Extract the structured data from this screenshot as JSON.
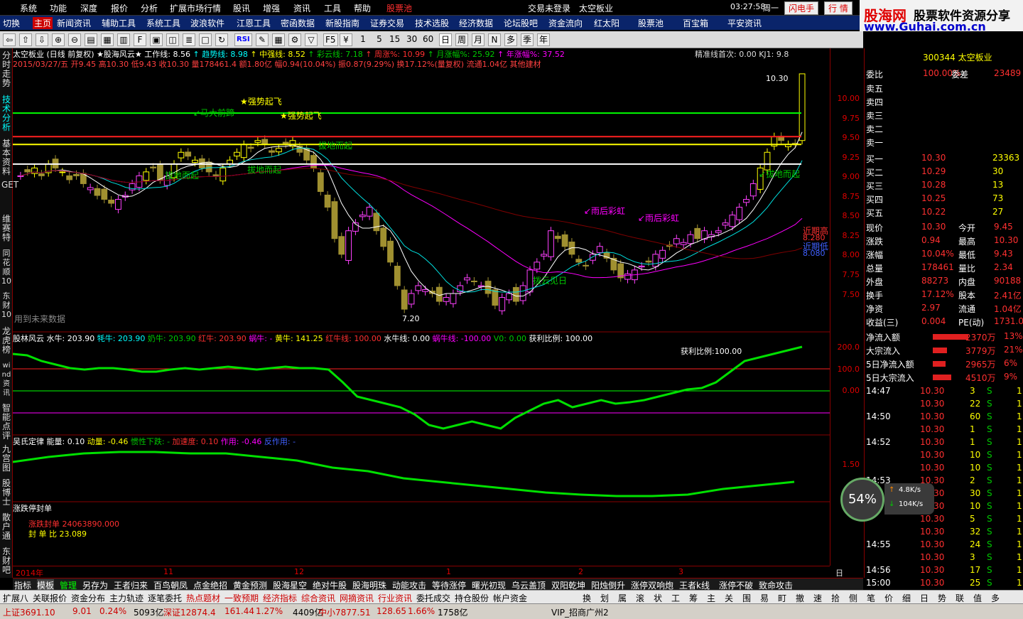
{
  "menu": {
    "items": [
      "系统",
      "功能",
      "深度",
      "报价",
      "分析",
      "扩展市场行情",
      "股讯",
      "增强",
      "资讯",
      "工具",
      "帮助",
      "股票池"
    ],
    "login": "交易未登录",
    "stock_title": "太空板业",
    "time": "03:27:58",
    "weekday": "周一",
    "btn_flash": "闪电手",
    "btn_quote": "行  情"
  },
  "brand": {
    "name": "股海网",
    "slogan": "股票软件资源分享",
    "url": "www.Guhai.com.cn"
  },
  "toolbar1": [
    "切换",
    "主页",
    "新闻资讯",
    "辅助工具",
    "系统工具",
    "波浪软件",
    "江恩工具",
    "密函数据",
    "新股指南",
    "证券交易",
    "技术选股",
    "经济数据",
    "论坛股吧",
    "资金流向",
    "红太阳",
    "股票池",
    "百宝箱",
    "平安资讯"
  ],
  "toolbar2": {
    "periods": [
      "1",
      "5",
      "15",
      "30",
      "60",
      "日",
      "周",
      "月",
      "N",
      "多",
      "季",
      "年"
    ],
    "rsi": "RSI"
  },
  "side_tabs": [
    "分时走势",
    "技术分析",
    "基本资料",
    "GET",
    "维赛特",
    "同花顺10",
    "东财10",
    "龙虎榜",
    "wind资讯",
    "智能点评",
    "九宫图",
    "股博士",
    "散户通",
    "东财吧"
  ],
  "header": {
    "line1": [
      {
        "t": "太空板业 (日线 前复权) ★股海风云★ 工作线: 8.56",
        "c": "ww"
      },
      {
        "t": "↑ 趋势线: 8.98",
        "c": "cc"
      },
      {
        "t": "↑ 中强线: 8.52",
        "c": "yy"
      },
      {
        "t": "↑ 彩云线: 7.18",
        "c": "gg"
      },
      {
        "t": "↑ 周涨%: 10.99",
        "c": "rr"
      },
      {
        "t": "↑ 月涨幅%: 25.92",
        "c": "gg"
      },
      {
        "t": "↑ 年涨幅%: 37.52",
        "c": "mm"
      }
    ],
    "line2": "2015/03/27/五 开9.45 高10.30 低9.43 收10.30 量178461.4 额1.80亿 幅0.94(10.04%) 振0.87(9.29%) 换17.12%(量复权) 流通1.04亿 其他建材",
    "precision": "精准线首次: 0.00  KJ1: 9.8"
  },
  "annotations": {
    "qsqf1": "★强势起飞",
    "qsqf2": "★强势起飞",
    "mdqt": "↙马大前蹄",
    "bdqi1": "拔地而起",
    "bdqi2": "拔地而起",
    "bdqi3": "拔地而起",
    "bdqi4": "↙拔地而起",
    "yhch1": "↙雨后彩虹",
    "yhch2": "↙雨后彩虹",
    "byjr": "拨云见日",
    "jqg": "近期高",
    "jqd": "近期低",
    "future": "用到未来数据",
    "high": "10.30",
    "low": "7.20",
    "jqg_val": "8.280",
    "jqd_val": "8.080"
  },
  "price_axis": [
    "10.00",
    "9.75",
    "9.50",
    "9.25",
    "9.00",
    "8.75",
    "8.50",
    "8.25",
    "8.00",
    "7.75",
    "7.50"
  ],
  "indicator1": {
    "title": "股林风云",
    "items": [
      {
        "t": "水牛: 203.90",
        "c": "ww"
      },
      {
        "t": "牦牛: 203.90",
        "c": "cc"
      },
      {
        "t": "奶牛: 203.90",
        "c": "gg"
      },
      {
        "t": "红牛: 203.90",
        "c": "rr"
      },
      {
        "t": "蜗牛: -",
        "c": "mm"
      },
      {
        "t": "黄牛: 141.25",
        "c": "yy"
      },
      {
        "t": "红牛线: 100.00",
        "c": "rr"
      },
      {
        "t": "水牛线: 0.00",
        "c": "ww"
      },
      {
        "t": "蜗牛线: -100.00",
        "c": "mm"
      },
      {
        "t": "V0: 0.00",
        "c": "gg"
      },
      {
        "t": "获利比例: 100.00",
        "c": "ww"
      }
    ],
    "label": "获利比例:100.00",
    "axis": [
      "200.0",
      "100.0",
      "0.00"
    ]
  },
  "indicator2": {
    "title": "吴氏定律",
    "items": [
      {
        "t": "能量: 0.10",
        "c": "ww"
      },
      {
        "t": "动量: -0.46",
        "c": "yy"
      },
      {
        "t": "惯性下跌: -",
        "c": "gg"
      },
      {
        "t": "加速度: 0.10",
        "c": "rr"
      },
      {
        "t": "作用: -0.46",
        "c": "mm"
      },
      {
        "t": "反作用: -",
        "c": "cc"
      }
    ],
    "axis": "1.50"
  },
  "indicator3": {
    "title": "涨跌停封单",
    "l1": "涨跌封单  24063890.000",
    "l2": "封 单 比  23.089"
  },
  "date_axis": [
    "2014年",
    "11",
    "12",
    "1",
    "2",
    "3"
  ],
  "date_right": "日线",
  "quote": {
    "code": "300344 太空板业",
    "wb": "100.00%",
    "wc": "23489",
    "sell": [
      "卖五",
      "卖四",
      "卖三",
      "卖二",
      "卖一"
    ],
    "buy": [
      [
        "买一",
        "10.30",
        "23363"
      ],
      [
        "买二",
        "10.29",
        "30"
      ],
      [
        "买三",
        "10.28",
        "13"
      ],
      [
        "买四",
        "10.25",
        "73"
      ],
      [
        "买五",
        "10.22",
        "27"
      ]
    ],
    "stats": [
      [
        "现价",
        "10.30",
        "今开",
        "9.45"
      ],
      [
        "涨跌",
        "0.94",
        "最高",
        "10.30"
      ],
      [
        "涨幅",
        "10.04%",
        "最低",
        "9.43"
      ],
      [
        "总量",
        "178461",
        "量比",
        "2.34"
      ],
      [
        "外盘",
        "88273",
        "内盘",
        "90188"
      ],
      [
        "换手",
        "17.12%",
        "股本",
        "2.41亿"
      ],
      [
        "净资",
        "2.97",
        "流通",
        "1.04亿"
      ],
      [
        "收益(三)",
        "0.004",
        "PE(动)",
        "1731.0"
      ]
    ],
    "flow": [
      [
        "净流入额",
        "2370万",
        "13%"
      ],
      [
        "大宗流入",
        "3779万",
        "21%"
      ],
      [
        "5日净流入额",
        "2965万",
        "6%"
      ],
      [
        "5日大宗流入",
        "4510万",
        "9%"
      ]
    ],
    "ticks": [
      [
        "14:47",
        "10.30",
        "3",
        "S",
        "1"
      ],
      [
        "",
        "10.30",
        "22",
        "S",
        "1"
      ],
      [
        "14:50",
        "10.30",
        "60",
        "S",
        "1"
      ],
      [
        "",
        "10.30",
        "1",
        "S",
        "1"
      ],
      [
        "14:52",
        "10.30",
        "1",
        "S",
        "1"
      ],
      [
        "",
        "10.30",
        "10",
        "S",
        "1"
      ],
      [
        "",
        "10.30",
        "10",
        "S",
        "1"
      ],
      [
        "14:53",
        "10.30",
        "2",
        "S",
        "1"
      ],
      [
        "",
        "10.30",
        "30",
        "S",
        "1"
      ],
      [
        "",
        "10.30",
        "10",
        "S",
        "1"
      ],
      [
        "",
        "10.30",
        "5",
        "S",
        "1"
      ],
      [
        "",
        "10.30",
        "32",
        "S",
        "1"
      ],
      [
        "14:55",
        "10.30",
        "24",
        "S",
        "1"
      ],
      [
        "",
        "10.30",
        "3",
        "S",
        "1"
      ],
      [
        "14:56",
        "10.30",
        "17",
        "S",
        "1"
      ],
      [
        "15:00",
        "10.30",
        "25",
        "S",
        "1"
      ]
    ],
    "speed": {
      "pct": "54%",
      "up": "4.8K/s",
      "down": "104K/s"
    }
  },
  "bottom_tabs": [
    "指标",
    "模板",
    "管理",
    "另存为",
    "王者归来",
    "百鸟朝凤",
    "点金绝招",
    "黄金预测",
    "股海星空",
    "绝对牛股",
    "股海明珠",
    "动能攻击",
    "等待涨停",
    "曙光初现",
    "乌云盖顶",
    "双阳乾坤",
    "阳烛倒升",
    "涨停双响炮",
    "王者k线",
    "涨停不破",
    "致命攻击"
  ],
  "toolbar3": [
    "扩展八",
    "关联报价",
    "资金分布",
    "主力轨迹",
    "逐笔委托",
    "热点题材",
    "一致预期",
    "经济指标",
    "综合资讯",
    "网摘资讯",
    "行业资讯",
    "委托成交",
    "持仓股份",
    "帐户资金"
  ],
  "toolbar3r": [
    "换",
    "划",
    "属",
    "滚",
    "状",
    "工",
    "筹",
    "主",
    "关",
    "围",
    "易",
    "町",
    "撤",
    "速",
    "拾",
    "侧",
    "笔",
    "价",
    "细",
    "日",
    "势",
    "联",
    "值",
    "多"
  ],
  "status": {
    "sh": "上证3691.10",
    "sh_ch": "9.01",
    "sh_pct": "0.24%",
    "sh_vol": "5093亿",
    "sz": "深证12874.4",
    "sz_ch": "161.44",
    "sz_pct": "1.27%",
    "sz_vol": "4409亿",
    "zx": "中小7877.51",
    "zx_ch": "128.65",
    "zx_pct": "1.66%",
    "zx_vol": "1758亿",
    "vip": "VIP_招商广州2"
  },
  "chart_data": {
    "type": "candlestick",
    "title": "太空板业 (日线 前复权)",
    "y_range": [
      7.2,
      10.3
    ],
    "last": {
      "open": 9.45,
      "high": 10.3,
      "low": 9.43,
      "close": 10.3
    },
    "markers": {
      "high": 10.3,
      "low": 7.2
    }
  }
}
